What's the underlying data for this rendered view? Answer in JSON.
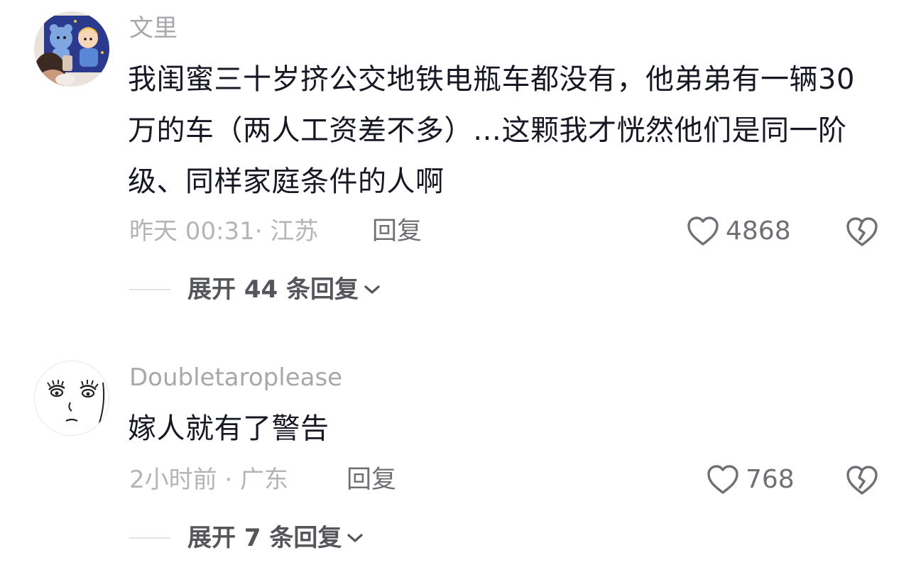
{
  "comments": [
    {
      "username": "文里",
      "text": "我闺蜜三十岁挤公交地铁电瓶车都没有，他弟弟有一辆30万的车（两人工资差不多）…这颗我才恍然他们是同一阶级、同样家庭条件的人啊",
      "meta": "昨天 00:31· 江苏",
      "reply_label": "回复",
      "like_count": "4868",
      "expand_label": "展开 44 条回复"
    },
    {
      "username": "Doubletaroplease",
      "text": "嫁人就有了警告",
      "meta": "2小时前 · 广东",
      "reply_label": "回复",
      "like_count": "768",
      "expand_label": "展开 7 条回复"
    }
  ],
  "icons": {
    "like": "heart-outline-icon",
    "dislike": "broken-heart-icon",
    "expand": "chevron-down-icon"
  },
  "colors": {
    "username": "#a7a8ac",
    "body_text": "#161823",
    "meta": "#b4b5b8",
    "action": "#6f7075",
    "expand": "#55565b"
  }
}
